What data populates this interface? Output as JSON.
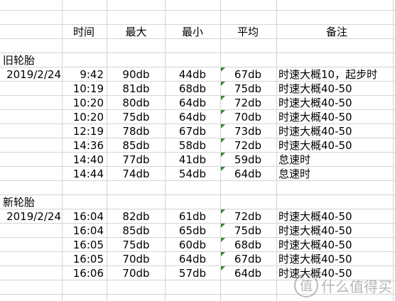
{
  "headers": {
    "time": "时间",
    "max": "最大",
    "min": "最小",
    "avg": "平均",
    "note": "备注"
  },
  "sections": [
    {
      "label": "旧轮胎",
      "date": "2019/2/24",
      "rows": [
        {
          "time": "9:42",
          "max": "90db",
          "min": "44db",
          "avg": "67db",
          "note": "时速大概10，起步时"
        },
        {
          "time": "10:19",
          "max": "81db",
          "min": "68db",
          "avg": "75db",
          "note": "时速大概40-50"
        },
        {
          "time": "10:20",
          "max": "80db",
          "min": "64db",
          "avg": "72db",
          "note": "时速大概40-50"
        },
        {
          "time": "10:20",
          "max": "75db",
          "min": "64db",
          "avg": "70db",
          "note": "时速大概40-50"
        },
        {
          "time": "12:19",
          "max": "78db",
          "min": "67db",
          "avg": "73db",
          "note": "时速大概40-50"
        },
        {
          "time": "14:36",
          "max": "85db",
          "min": "58db",
          "avg": "72db",
          "note": "时速大概40-50"
        },
        {
          "time": "14:40",
          "max": "77db",
          "min": "41db",
          "avg": "59db",
          "note": "怠速时"
        },
        {
          "time": "14:44",
          "max": "74db",
          "min": "54db",
          "avg": "64db",
          "note": "怠速时"
        }
      ]
    },
    {
      "label": "新轮胎",
      "date": "2019/2/24",
      "rows": [
        {
          "time": "16:04",
          "max": "82db",
          "min": "61db",
          "avg": "72db",
          "note": "时速大概40-50"
        },
        {
          "time": "16:04",
          "max": "85db",
          "min": "65db",
          "avg": "75db",
          "note": "时速大概40-50"
        },
        {
          "time": "16:05",
          "max": "75db",
          "min": "60db",
          "avg": "68db",
          "note": "时速大概40-50"
        },
        {
          "time": "16:05",
          "max": "70db",
          "min": "64db",
          "avg": "67db",
          "note": "时速大概40-50"
        },
        {
          "time": "16:06",
          "max": "70db",
          "min": "57db",
          "avg": "64db",
          "note": "时速大概40-50"
        }
      ]
    }
  ],
  "watermark": {
    "logo_glyph": "值",
    "text": "什么值得买"
  },
  "colors": {
    "grid": "#d4d4d4",
    "flag": "#2e8b2e"
  }
}
